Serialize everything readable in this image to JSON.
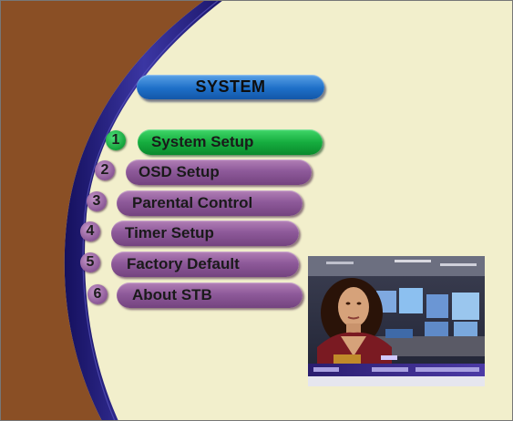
{
  "menu": {
    "title": "SYSTEM",
    "items": [
      {
        "number": "1",
        "label": "System Setup",
        "selected": true
      },
      {
        "number": "2",
        "label": "OSD Setup",
        "selected": false
      },
      {
        "number": "3",
        "label": "Parental Control",
        "selected": false
      },
      {
        "number": "4",
        "label": "Timer Setup",
        "selected": false
      },
      {
        "number": "5",
        "label": "Factory Default",
        "selected": false
      },
      {
        "number": "6",
        "label": "About STB",
        "selected": false
      }
    ]
  },
  "colors": {
    "background": "#f2efcc",
    "left_panel": "#8a4f25",
    "swoosh": "#2e2a8a",
    "title_pill": "#1e6fc8",
    "selected_item": "#16ad3f",
    "menu_item": "#8e5a9a"
  },
  "preview": {
    "description_icon": "tv-preview-window"
  }
}
